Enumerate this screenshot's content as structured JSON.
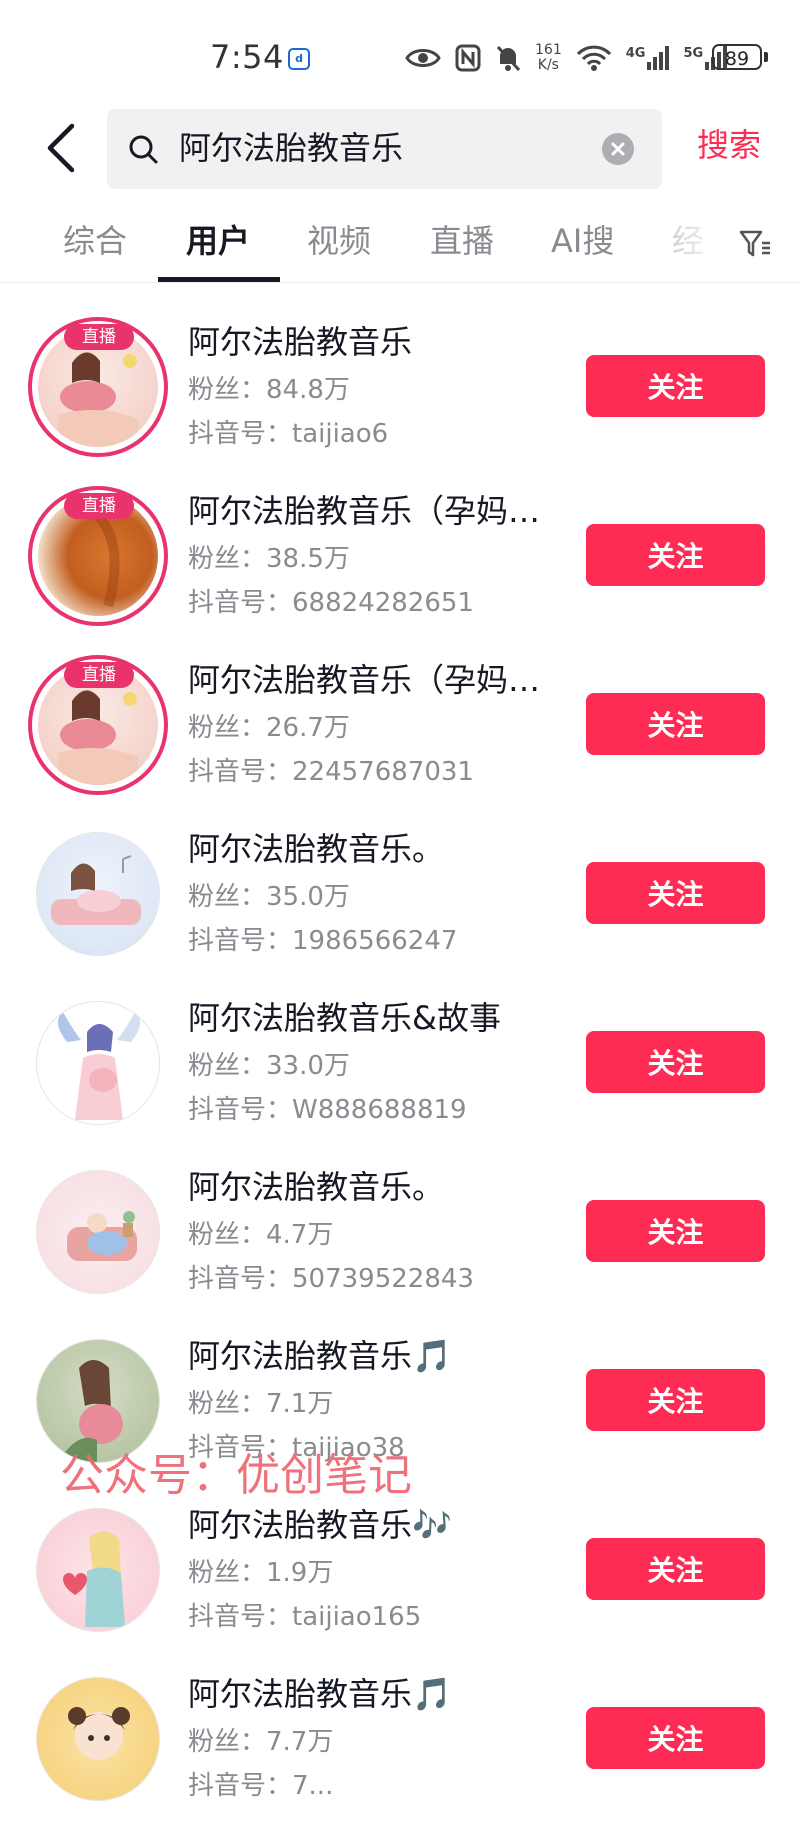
{
  "status_bar": {
    "time": "7:54",
    "speed_value": "161",
    "speed_unit": "K/s",
    "net_4g": "4G",
    "net_5g": "5G",
    "battery": "89",
    "app_icon_glyph": "d"
  },
  "search": {
    "query": "阿尔法胎教音乐",
    "button_label": "搜索"
  },
  "tabs": [
    {
      "label": "综合"
    },
    {
      "label": "用户"
    },
    {
      "label": "视频"
    },
    {
      "label": "直播"
    },
    {
      "label": "AI搜"
    },
    {
      "label": "经"
    }
  ],
  "active_tab": "用户",
  "colors": {
    "accent": "#fe2c55",
    "live_ring": "#e8336d",
    "secondary_text": "#8a8b91"
  },
  "users": [
    {
      "name": "阿尔法胎教音乐",
      "fans": "粉丝：84.8万",
      "douyin_id": "抖音号：taijiao6",
      "live_badge": "直播",
      "follow_label": "关注"
    },
    {
      "name": "阿尔法胎教音乐（孕妈…",
      "fans": "粉丝：38.5万",
      "douyin_id": "抖音号：68824282651",
      "live_badge": "直播",
      "follow_label": "关注"
    },
    {
      "name": "阿尔法胎教音乐（孕妈…",
      "fans": "粉丝：26.7万",
      "douyin_id": "抖音号：22457687031",
      "live_badge": "直播",
      "follow_label": "关注"
    },
    {
      "name": "阿尔法胎教音乐。",
      "fans": "粉丝：35.0万",
      "douyin_id": "抖音号：1986566247",
      "live_badge": null,
      "follow_label": "关注"
    },
    {
      "name": "阿尔法胎教音乐&故事",
      "fans": "粉丝：33.0万",
      "douyin_id": "抖音号：W888688819",
      "live_badge": null,
      "follow_label": "关注"
    },
    {
      "name": "阿尔法胎教音乐。",
      "fans": "粉丝：4.7万",
      "douyin_id": "抖音号：50739522843",
      "live_badge": null,
      "follow_label": "关注"
    },
    {
      "name": "阿尔法胎教音乐🎵",
      "fans": "粉丝：7.1万",
      "douyin_id": "抖音号：taijiao38",
      "live_badge": null,
      "follow_label": "关注"
    },
    {
      "name": "阿尔法胎教音乐🎶",
      "fans": "粉丝：1.9万",
      "douyin_id": "抖音号：taijiao165",
      "live_badge": null,
      "follow_label": "关注"
    },
    {
      "name": "阿尔法胎教音乐🎵",
      "fans": "粉丝：7.7万",
      "douyin_id": "抖音号：7...",
      "live_badge": null,
      "follow_label": "关注"
    }
  ],
  "watermark": "公众号：优创笔记"
}
